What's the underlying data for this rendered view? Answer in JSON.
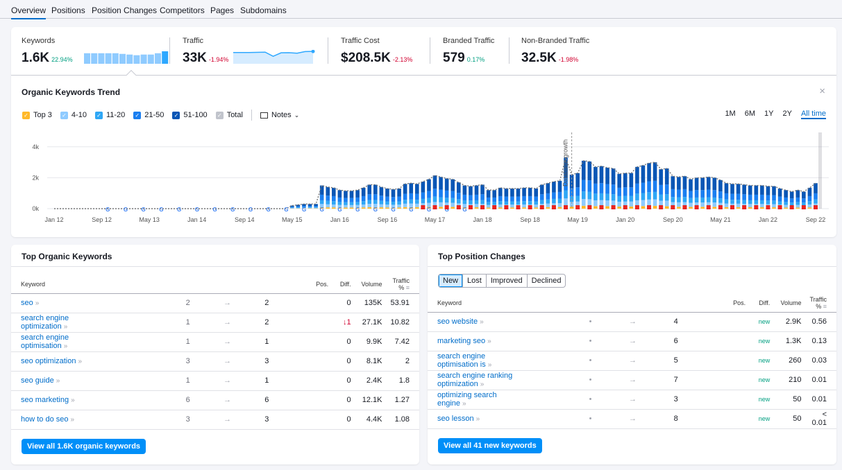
{
  "tabs": [
    "Overview",
    "Positions",
    "Position Changes",
    "Competitors",
    "Pages",
    "Subdomains"
  ],
  "metrics": [
    {
      "label": "Keywords",
      "value": "1.6K",
      "change": "22.94%",
      "trend": "positive",
      "sparkline_bars": [
        8,
        8,
        8,
        8,
        8,
        7.5,
        7,
        6.5,
        7,
        7,
        8,
        9.5
      ]
    },
    {
      "label": "Traffic",
      "value": "33K",
      "change": "-1.94%",
      "trend": "negative",
      "sparkline_line": [
        9,
        9,
        9,
        9.2,
        9.3,
        6,
        8.8,
        8.9,
        8.5,
        9.8,
        9.9
      ]
    },
    {
      "label": "Traffic Cost",
      "value": "$208.5K",
      "change": "-2.13%",
      "trend": "negative"
    },
    {
      "label": "Branded Traffic",
      "value": "579",
      "change": "0.17%",
      "trend": "positive"
    },
    {
      "label": "Non-Branded Traffic",
      "value": "32.5K",
      "change": "-1.98%",
      "trend": "negative"
    }
  ],
  "trend": {
    "title": "Organic Keywords Trend",
    "close_icon": "close-icon",
    "legend": [
      {
        "label": "Top 3",
        "color": "#ffb92a"
      },
      {
        "label": "4-10",
        "color": "#8fcbff"
      },
      {
        "label": "11-20",
        "color": "#2fa7f5"
      },
      {
        "label": "21-50",
        "color": "#1a7ef0"
      },
      {
        "label": "51-100",
        "color": "#0a56b5"
      },
      {
        "label": "Total",
        "color": "#c1c4cc"
      }
    ],
    "notes_label": "Notes",
    "ranges": [
      "1M",
      "6M",
      "1Y",
      "2Y",
      "All time"
    ],
    "active_range": "All time"
  },
  "chart_data": {
    "type": "bar",
    "stacked": true,
    "x_start": "Jan 2012",
    "x_end": "Sep 2022",
    "x_step": "month",
    "xticks": [
      "Jan 12",
      "Sep 12",
      "May 13",
      "Jan 14",
      "Sep 14",
      "May 15",
      "Jan 16",
      "Sep 16",
      "May 17",
      "Jan 18",
      "Sep 18",
      "May 19",
      "Jan 20",
      "Sep 20",
      "May 21",
      "Jan 22",
      "Sep 22"
    ],
    "yticks": [
      "0k",
      "2k",
      "4k"
    ],
    "ylim": [
      0,
      4.5
    ],
    "yunit": "k",
    "grid": true,
    "annotation": {
      "label": "Database growth",
      "date": "Apr 2019"
    },
    "approx_band_share": {
      "Top 3": 0.06,
      "4-10": 0.14,
      "11-20": 0.16,
      "21-50": 0.24,
      "51-100": 0.4
    },
    "totals": [
      0,
      0,
      0,
      0,
      0,
      0,
      0,
      0,
      0,
      0,
      0,
      0,
      0,
      0,
      0,
      0,
      0,
      0,
      0,
      0,
      0,
      0,
      0,
      0,
      0,
      0,
      0,
      0,
      0,
      0,
      0,
      0,
      0,
      0,
      0,
      0,
      0,
      0,
      0,
      0,
      0.2,
      0.25,
      0.3,
      0.3,
      0.3,
      1.5,
      1.4,
      1.35,
      1.2,
      1.15,
      1.15,
      1.2,
      1.35,
      1.55,
      1.55,
      1.4,
      1.3,
      1.25,
      1.3,
      1.6,
      1.65,
      1.6,
      1.75,
      1.9,
      2.15,
      2.05,
      1.95,
      1.9,
      1.7,
      1.5,
      1.45,
      1.5,
      1.55,
      1.2,
      1.2,
      1.35,
      1.3,
      1.3,
      1.3,
      1.35,
      1.35,
      1.3,
      1.55,
      1.65,
      1.75,
      1.8,
      3.3,
      2.2,
      2.3,
      3.1,
      3.05,
      2.7,
      2.75,
      2.65,
      2.6,
      2.25,
      2.3,
      2.3,
      2.7,
      2.8,
      2.95,
      3.0,
      2.55,
      2.6,
      2.1,
      2.05,
      2.1,
      1.9,
      2.0,
      2.0,
      2.05,
      2.0,
      1.85,
      1.65,
      1.6,
      1.6,
      1.55,
      1.5,
      1.5,
      1.5,
      1.45,
      1.45,
      1.3,
      1.2,
      1.1,
      1.2,
      1.1,
      1.35,
      1.65
    ]
  },
  "top_keywords": {
    "title": "Top Organic Keywords",
    "columns": [
      "Keyword",
      "Pos.",
      "Diff.",
      "Volume",
      "Traffic %"
    ],
    "rows": [
      {
        "keyword": "seo",
        "from": "2",
        "to": "2",
        "diff": "0",
        "volume": "135K",
        "traffic": "53.91"
      },
      {
        "keyword": "search engine optimization",
        "from": "1",
        "to": "2",
        "diff": "1",
        "diff_dir": "down",
        "volume": "27.1K",
        "traffic": "10.82"
      },
      {
        "keyword": "search engine optimisation",
        "from": "1",
        "to": "1",
        "diff": "0",
        "volume": "9.9K",
        "traffic": "7.42"
      },
      {
        "keyword": "seo optimization",
        "from": "3",
        "to": "3",
        "diff": "0",
        "volume": "8.1K",
        "traffic": "2"
      },
      {
        "keyword": "seo guide",
        "from": "1",
        "to": "1",
        "diff": "0",
        "volume": "2.4K",
        "traffic": "1.8"
      },
      {
        "keyword": "seo marketing",
        "from": "6",
        "to": "6",
        "diff": "0",
        "volume": "12.1K",
        "traffic": "1.27"
      },
      {
        "keyword": "how to do seo",
        "from": "3",
        "to": "3",
        "diff": "0",
        "volume": "4.4K",
        "traffic": "1.08"
      }
    ],
    "button": "View all 1.6K organic keywords"
  },
  "position_changes": {
    "title": "Top Position Changes",
    "filters": [
      "New",
      "Lost",
      "Improved",
      "Declined"
    ],
    "active_filter": "New",
    "columns": [
      "Keyword",
      "Pos.",
      "Diff.",
      "Volume",
      "Traffic %"
    ],
    "rows": [
      {
        "keyword": "seo website",
        "to": "4",
        "diff": "new",
        "volume": "2.9K",
        "traffic": "0.56"
      },
      {
        "keyword": "marketing seo",
        "to": "6",
        "diff": "new",
        "volume": "1.3K",
        "traffic": "0.13"
      },
      {
        "keyword": "search engine optimisation is",
        "to": "5",
        "diff": "new",
        "volume": "260",
        "traffic": "0.03"
      },
      {
        "keyword": "search engine ranking optimization",
        "to": "7",
        "diff": "new",
        "volume": "210",
        "traffic": "0.01"
      },
      {
        "keyword": "optimizing search engine",
        "to": "3",
        "diff": "new",
        "volume": "50",
        "traffic": "0.01"
      },
      {
        "keyword": "seo lesson",
        "to": "8",
        "diff": "new",
        "volume": "50",
        "traffic": "< 0.01"
      }
    ],
    "button": "View all 41 new keywords"
  }
}
